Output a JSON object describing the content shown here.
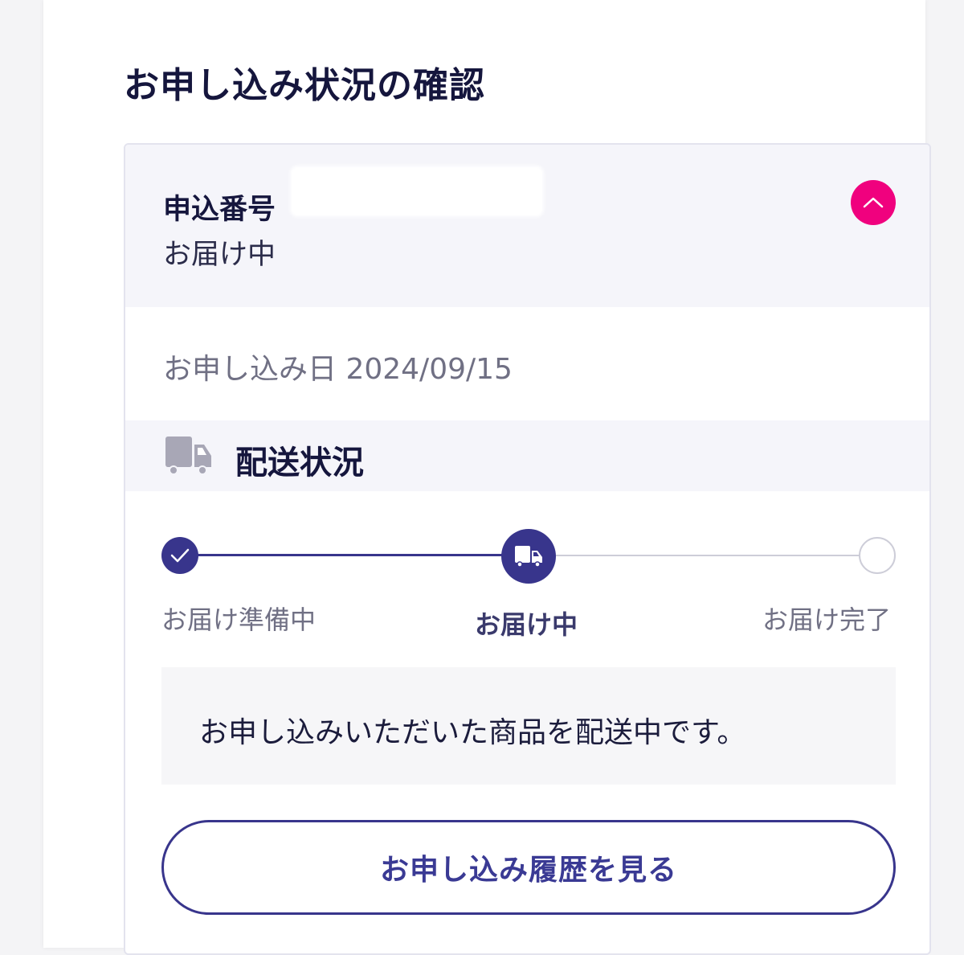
{
  "page": {
    "title": "お申し込み状況の確認"
  },
  "order": {
    "number_label": "申込番号",
    "status": "お届け中",
    "date_text": "お申し込み日 2024/09/15"
  },
  "shipping": {
    "title": "配送状況",
    "steps": [
      {
        "label": "お届け準備中",
        "state": "done"
      },
      {
        "label": "お届け中",
        "state": "current"
      },
      {
        "label": "お届け完了",
        "state": "todo"
      }
    ],
    "message": "お申し込みいただいた商品を配送中です。"
  },
  "buttons": {
    "history_label": "お申し込み履歴を見る"
  },
  "icons": {
    "collapse": "chevron-up-icon",
    "shipping": "truck-icon",
    "done": "checkmark-icon",
    "current": "truck-icon"
  },
  "colors": {
    "accent": "#38358c",
    "collapse_button": "#f0017e",
    "muted": "#707084",
    "header_bg": "#f5f5fa"
  }
}
